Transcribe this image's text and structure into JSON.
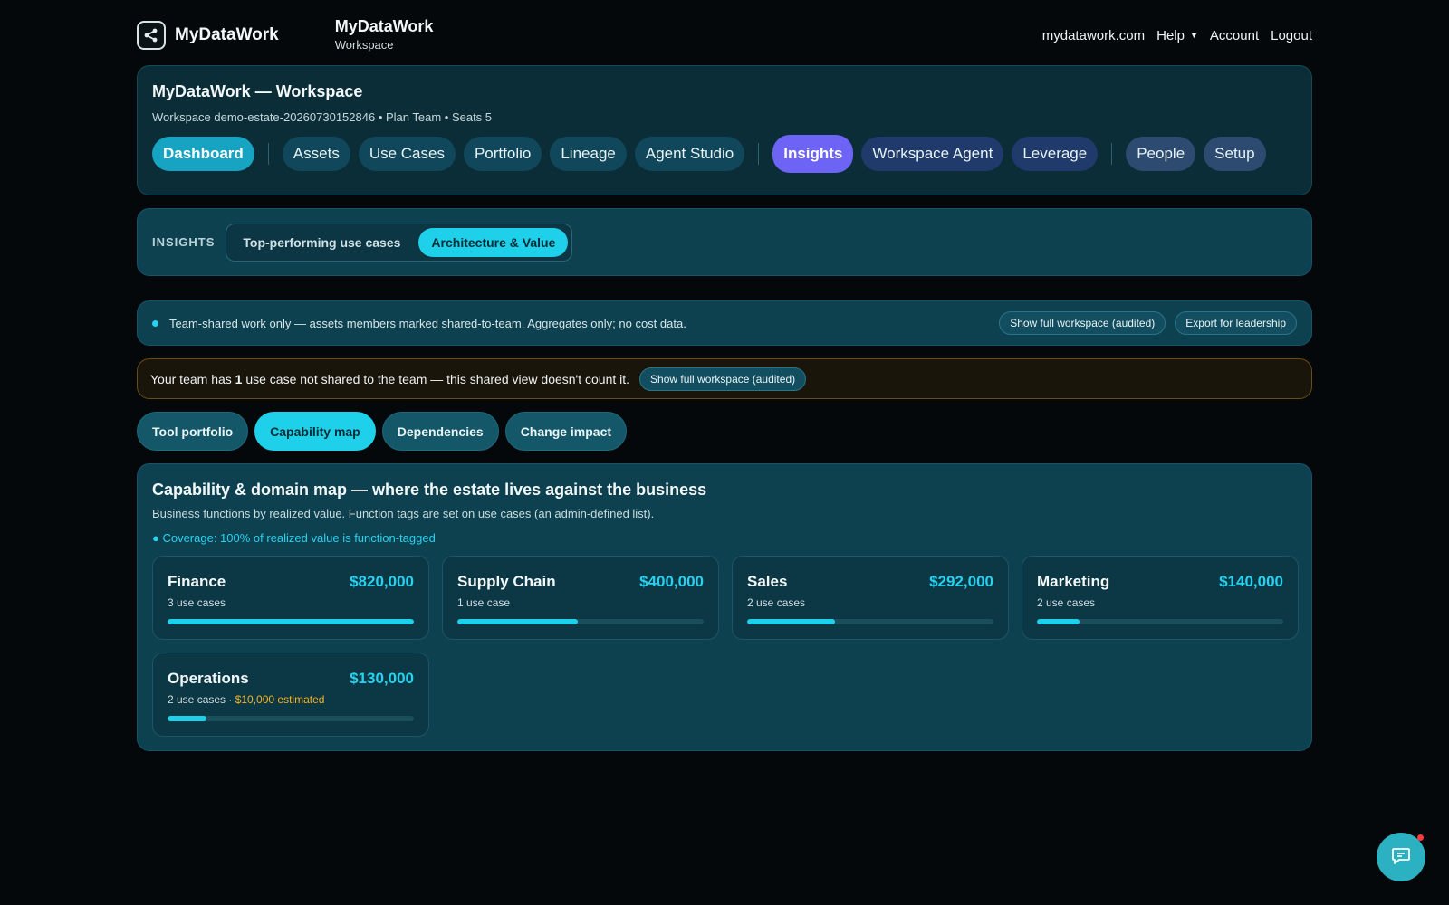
{
  "brand": {
    "name": "MyDataWork"
  },
  "app": {
    "title": "MyDataWork",
    "subtitle": "Workspace"
  },
  "topnav": {
    "site": "mydatawork.com",
    "help": "Help",
    "account": "Account",
    "logout": "Logout"
  },
  "workspace": {
    "title": "MyDataWork — Workspace",
    "meta": "Workspace demo-estate-20260730152846 • Plan Team • Seats 5",
    "tabs": [
      {
        "label": "Dashboard"
      },
      {
        "label": "Assets"
      },
      {
        "label": "Use Cases"
      },
      {
        "label": "Portfolio"
      },
      {
        "label": "Lineage"
      },
      {
        "label": "Agent Studio"
      },
      {
        "label": "Insights"
      },
      {
        "label": "Workspace Agent"
      },
      {
        "label": "Leverage"
      },
      {
        "label": "People"
      },
      {
        "label": "Setup"
      }
    ]
  },
  "insights": {
    "label": "INSIGHTS",
    "segments": [
      {
        "label": "Top-performing use cases",
        "active": false
      },
      {
        "label": "Architecture & Value",
        "active": true
      }
    ]
  },
  "notice": {
    "text": "Team-shared work only — assets members marked shared-to-team. Aggregates only; no cost data.",
    "btn_full": "Show full workspace (audited)",
    "btn_export": "Export for leadership"
  },
  "warning": {
    "prefix": "Your team has ",
    "count": "1",
    "suffix": " use case not shared to the team — this shared view doesn't count it.",
    "btn": "Show full workspace (audited)"
  },
  "subtabs": [
    {
      "label": "Tool portfolio",
      "active": false
    },
    {
      "label": "Capability map",
      "active": true
    },
    {
      "label": "Dependencies",
      "active": false
    },
    {
      "label": "Change impact",
      "active": false
    }
  ],
  "capability": {
    "title": "Capability & domain map — where the estate lives against the business",
    "subtitle": "Business functions by realized value. Function tags are set on use cases (an admin-defined list).",
    "coverage": "● Coverage: 100% of realized value is function-tagged",
    "functions": [
      {
        "name": "Finance",
        "value": "$820,000",
        "count": "3 use cases",
        "estimated": "",
        "share": 1.0
      },
      {
        "name": "Supply Chain",
        "value": "$400,000",
        "count": "1 use case",
        "estimated": "",
        "share": 0.49
      },
      {
        "name": "Sales",
        "value": "$292,000",
        "count": "2 use cases",
        "estimated": "",
        "share": 0.356
      },
      {
        "name": "Marketing",
        "value": "$140,000",
        "count": "2 use cases",
        "estimated": "",
        "share": 0.171
      },
      {
        "name": "Operations",
        "value": "$130,000",
        "count": "2 use cases · ",
        "estimated": "$10,000 estimated",
        "share": 0.159
      }
    ]
  },
  "colors": {
    "accent": "#1ed0ea",
    "violet": "#6d63f4",
    "warning": "#f0b429"
  }
}
